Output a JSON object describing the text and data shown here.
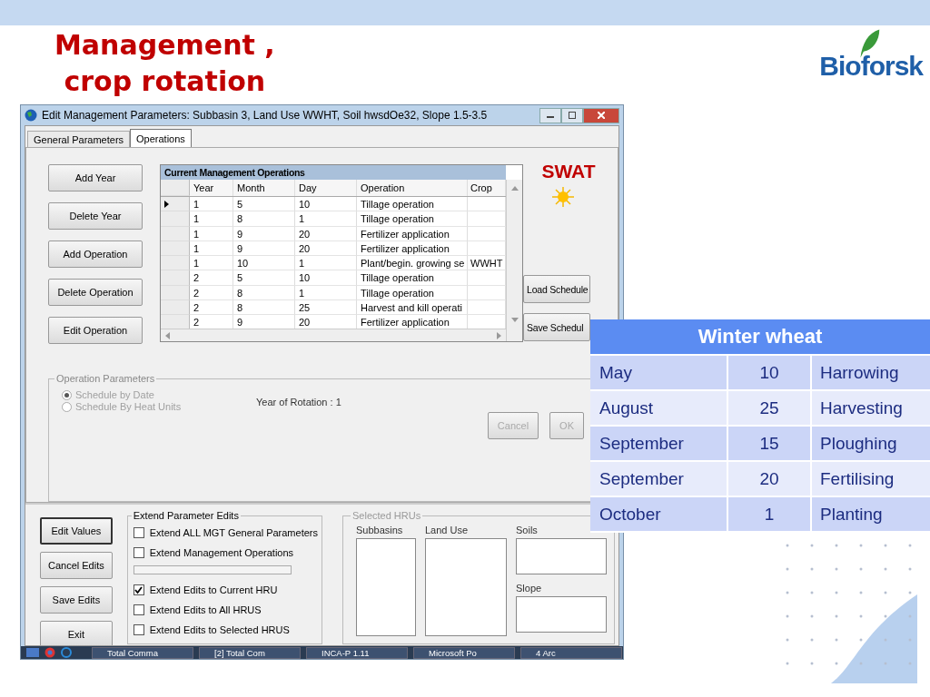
{
  "slide_title": [
    "Management ,",
    "crop rotation"
  ],
  "logo": {
    "text": "Bioforsk"
  },
  "window": {
    "title": "Edit Management Parameters: Subbasin 3, Land Use WWHT, Soil hwsdOe32, Slope 1.5-3.5",
    "tabs": [
      {
        "label": "General Parameters",
        "selected": false
      },
      {
        "label": "Operations",
        "selected": true
      }
    ],
    "left_buttons": [
      "Add Year",
      "Delete Year",
      "Add Operation",
      "Delete Operation",
      "Edit Operation"
    ],
    "grid": {
      "title": "Current Management Operations",
      "columns": [
        "Year",
        "Month",
        "Day",
        "Operation",
        "Crop"
      ],
      "rows": [
        {
          "selected": true,
          "cells": [
            "1",
            "5",
            "10",
            "Tillage operation",
            ""
          ]
        },
        {
          "selected": false,
          "cells": [
            "1",
            "8",
            "1",
            "Tillage operation",
            ""
          ]
        },
        {
          "selected": false,
          "cells": [
            "1",
            "9",
            "20",
            "Fertilizer application",
            ""
          ]
        },
        {
          "selected": false,
          "cells": [
            "1",
            "9",
            "20",
            "Fertilizer application",
            ""
          ]
        },
        {
          "selected": false,
          "cells": [
            "1",
            "10",
            "1",
            "Plant/begin. growing se",
            "WWHT"
          ]
        },
        {
          "selected": false,
          "cells": [
            "2",
            "5",
            "10",
            "Tillage operation",
            ""
          ]
        },
        {
          "selected": false,
          "cells": [
            "2",
            "8",
            "1",
            "Tillage operation",
            ""
          ]
        },
        {
          "selected": false,
          "cells": [
            "2",
            "8",
            "25",
            "Harvest and kill operati",
            ""
          ]
        },
        {
          "selected": false,
          "cells": [
            "2",
            "9",
            "20",
            "Fertilizer application",
            ""
          ]
        }
      ]
    },
    "swat_label": "SWAT",
    "right_buttons": [
      "Load Schedule",
      "Save Schedul"
    ],
    "operation_parameters": {
      "title": "Operation Parameters",
      "radios": [
        {
          "label": "Schedule by Date",
          "selected": true,
          "disabled": true
        },
        {
          "label": "Schedule By Heat Units",
          "selected": false,
          "disabled": true
        }
      ],
      "year_of_rotation": "Year of Rotation : 1",
      "buttons": [
        {
          "label": "Cancel",
          "disabled": true
        },
        {
          "label": "OK",
          "disabled": true
        }
      ]
    },
    "edit_buttons": [
      {
        "label": "Edit Values",
        "default": true
      },
      {
        "label": "Cancel Edits",
        "default": false
      },
      {
        "label": "Save Edits",
        "default": false
      },
      {
        "label": "Exit",
        "default": false
      }
    ],
    "extend_edits": {
      "title": "Extend Parameter Edits",
      "items": [
        {
          "kind": "checkbox",
          "label": "Extend ALL MGT General Parameters",
          "checked": false
        },
        {
          "kind": "checkbox",
          "label": "Extend Management Operations",
          "checked": false
        },
        {
          "kind": "progress",
          "level": 0
        },
        {
          "kind": "checkbox",
          "label": "Extend Edits to Current HRU",
          "checked": true
        },
        {
          "kind": "checkbox",
          "label": "Extend Edits to All HRUS",
          "checked": false
        },
        {
          "kind": "checkbox",
          "label": "Extend Edits to Selected HRUS",
          "checked": false
        }
      ]
    },
    "selected_hrus": {
      "title": "Selected HRUs",
      "disabled": true,
      "lists": [
        "Subbasins",
        "Land Use",
        "Soils",
        "Slope"
      ]
    },
    "taskbar": [
      "Total Comma",
      "[2] Total Com",
      "INCA-P 1.11",
      "Microsoft Po",
      "4 Arc"
    ]
  },
  "rotation_table": {
    "title": "Winter wheat",
    "rows": [
      [
        "May",
        "10",
        "Harrowing"
      ],
      [
        "August",
        "25",
        "Harvesting"
      ],
      [
        "September",
        "15",
        "Ploughing"
      ],
      [
        "September",
        "20",
        "Fertilising"
      ],
      [
        "October",
        "1",
        "Planting"
      ]
    ]
  }
}
